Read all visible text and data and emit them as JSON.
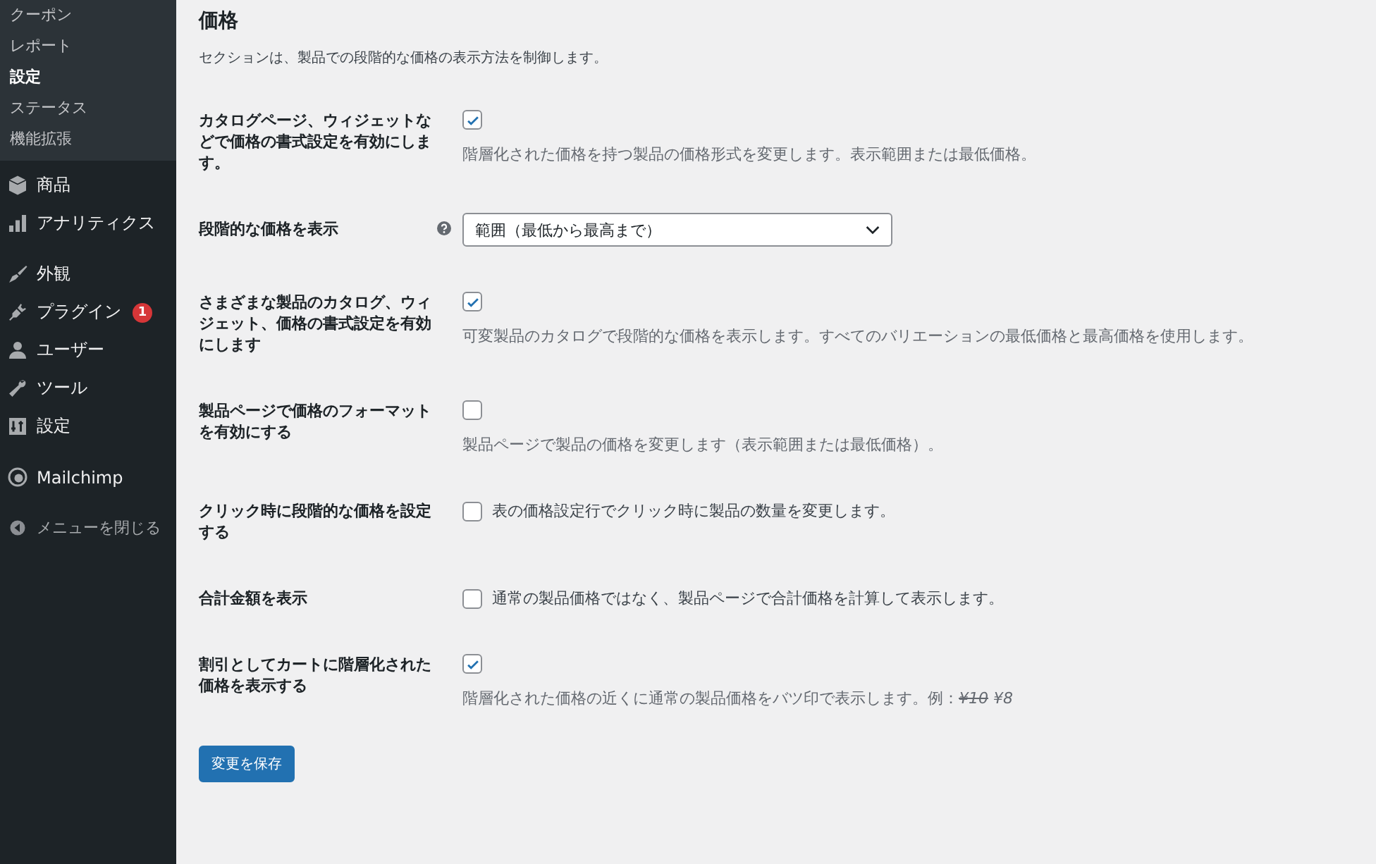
{
  "sidebar": {
    "submenu": [
      {
        "label": "クーポン",
        "selected": false
      },
      {
        "label": "レポート",
        "selected": false
      },
      {
        "label": "設定",
        "selected": true
      },
      {
        "label": "ステータス",
        "selected": false
      },
      {
        "label": "機能拡張",
        "selected": false
      }
    ],
    "groups": [
      [
        {
          "label": "商品"
        },
        {
          "label": "アナリティクス"
        }
      ],
      [
        {
          "label": "外観"
        },
        {
          "label": "プラグイン",
          "badge": "1"
        },
        {
          "label": "ユーザー"
        },
        {
          "label": "ツール"
        },
        {
          "label": "設定"
        }
      ],
      [
        {
          "label": "Mailchimp"
        }
      ],
      [
        {
          "label": "メニューを閉じる",
          "kind": "collapse"
        }
      ]
    ]
  },
  "section": {
    "title": "価格",
    "description": "セクションは、製品での段階的な価格の表示方法を制御します。"
  },
  "rows": [
    {
      "kind": "checkbox_stacked",
      "label": "カタログページ、ウィジェットなどで価格の書式設定を有効にします。",
      "checked": true,
      "description": "階層化された価格を持つ製品の価格形式を変更します。表示範囲または最低価格。"
    },
    {
      "kind": "select",
      "label": "段階的な価格を表示",
      "help": true,
      "value": "範囲（最低から最高まで）"
    },
    {
      "kind": "checkbox_stacked",
      "label": "さまざまな製品のカタログ、ウィジェット、価格の書式設定を有効にします",
      "checked": true,
      "description": "可変製品のカタログで段階的な価格を表示します。すべてのバリエーションの最低価格と最高価格を使用します。"
    },
    {
      "kind": "checkbox_stacked",
      "label": "製品ページで価格のフォーマットを有効にする",
      "checked": false,
      "description": "製品ページで製品の価格を変更します（表示範囲または最低価格）。"
    },
    {
      "kind": "checkbox_inline",
      "label": "クリック時に段階的な価格を設定する",
      "checked": false,
      "description": "表の価格設定行でクリック時に製品の数量を変更します。"
    },
    {
      "kind": "checkbox_inline",
      "label": "合計金額を表示",
      "checked": false,
      "description": "通常の製品価格ではなく、製品ページで合計価格を計算して表示します。"
    },
    {
      "kind": "checkbox_stacked",
      "label": "割引としてカートに階層化された価格を表示する",
      "checked": true,
      "description": "階層化された価格の近くに通常の製品価格をバツ印で表示します。例：",
      "example_old": "¥10",
      "example_new": "¥8"
    }
  ],
  "save_button": "変更を保存"
}
